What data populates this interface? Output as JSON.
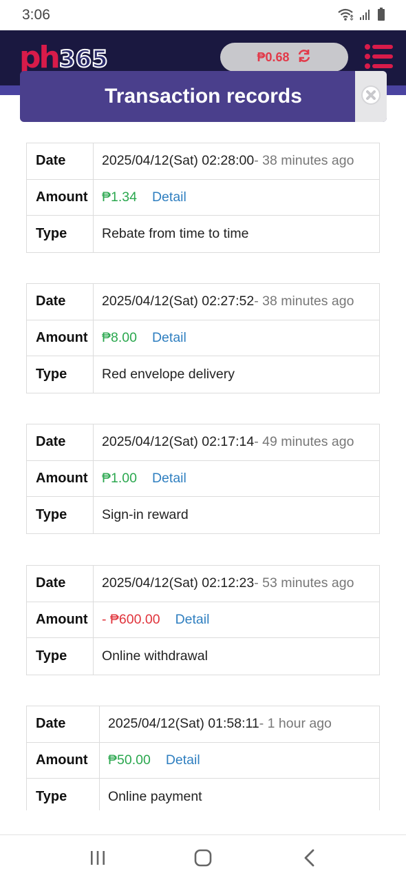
{
  "status_bar": {
    "time": "3:06"
  },
  "header": {
    "logo_text_ph": "ph",
    "logo_text_num": "365",
    "balance": "₱0.68"
  },
  "modal": {
    "title": "Transaction records"
  },
  "records": [
    {
      "date_label": "Date",
      "date": "2025/04/12(Sat) 02:28:00",
      "ago": "- 38 minutes ago",
      "amount_label": "Amount",
      "amount": "₱1.34",
      "detail": "Detail",
      "type_label": "Type",
      "type": "Rebate from time to time"
    },
    {
      "date_label": "Date",
      "date": "2025/04/12(Sat) 02:27:52",
      "ago": "- 38 minutes ago",
      "amount_label": "Amount",
      "amount": "₱8.00",
      "detail": "Detail",
      "type_label": "Type",
      "type": "Red envelope delivery"
    },
    {
      "date_label": "Date",
      "date": "2025/04/12(Sat) 02:17:14",
      "ago": "- 49 minutes ago",
      "amount_label": "Amount",
      "amount": "₱1.00",
      "detail": "Detail",
      "type_label": "Type",
      "type": "Sign-in reward"
    },
    {
      "date_label": "Date",
      "date": "2025/04/12(Sat) 02:12:23",
      "ago": "- 53 minutes ago",
      "amount_label": "Amount",
      "amount": "- ₱600.00",
      "detail": "Detail",
      "type_label": "Type",
      "type": "Online withdrawal"
    },
    {
      "date_label": "Date",
      "date": "2025/04/12(Sat) 01:58:11",
      "ago": "- 1 hour ago",
      "amount_label": "Amount",
      "amount": "₱50.00",
      "detail": "Detail",
      "type_label": "Type",
      "type": "Online payment"
    }
  ],
  "icons": {
    "wifi": "wifi-icon",
    "signal": "signal-icon",
    "battery": "battery-icon",
    "refresh": "refresh-icon",
    "menu": "menu-icon",
    "close": "close-icon",
    "nav_recents": "recents-icon",
    "nav_home": "home-icon",
    "nav_back": "back-icon"
  },
  "colors": {
    "header_bg": "#1a1840",
    "modal_title_bg": "#4a3f8c",
    "amount_positive": "#2aa74e",
    "amount_negative": "#e0333b",
    "link": "#2f7fc0",
    "brand_red": "#d81b4a"
  }
}
